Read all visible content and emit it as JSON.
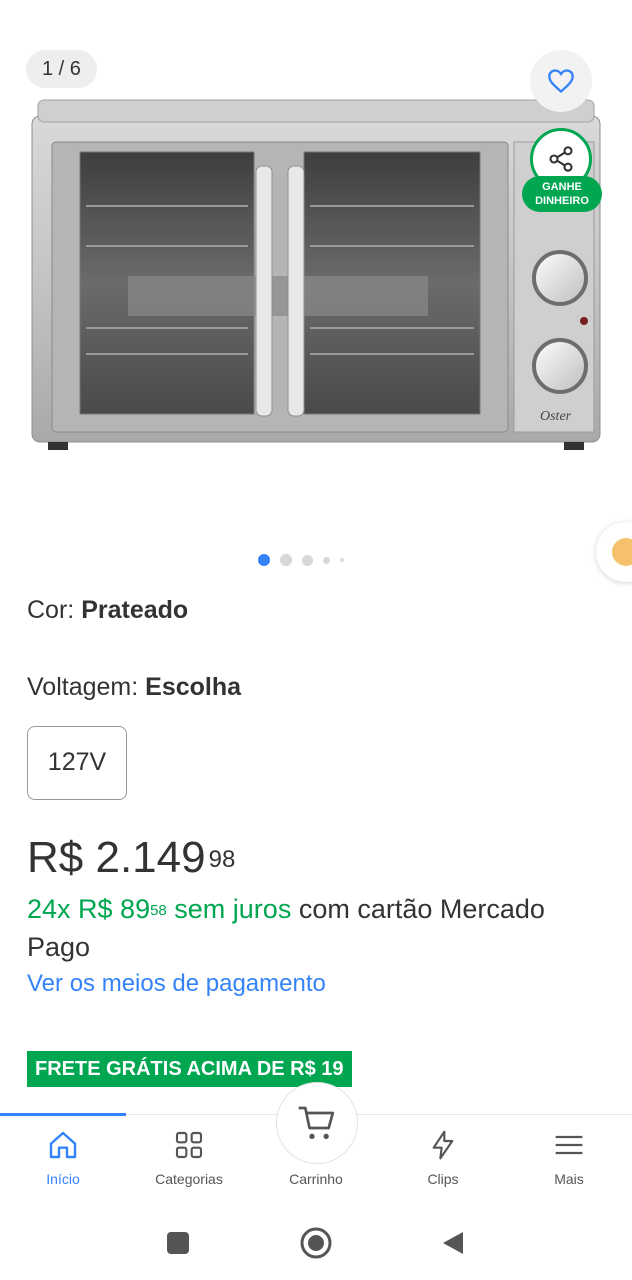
{
  "gallery": {
    "counter": "1 / 6",
    "current_slide": 1,
    "total_slides": 6,
    "share_badge": [
      "GANHE",
      "DINHEIRO"
    ],
    "brand_logo": "Oster",
    "favorite_icon": "heart-icon",
    "share_icon": "share-icon"
  },
  "variations": {
    "color_label": "Cor: ",
    "color_value": "Prateado",
    "voltage_label": "Voltagem: ",
    "voltage_value": "Escolha",
    "voltage_option": "127V"
  },
  "price": {
    "currency": "R$",
    "integer": "2.149",
    "cents": "98",
    "installments_prefix": "24x R$ 89",
    "installments_cents": "58",
    "installments_suffix": " sem juros",
    "installments_note": " com cartão Mercado Pago",
    "payment_link": "Ver os meios de pagamento"
  },
  "shipping_badge": "FRETE GRÁTIS ACIMA DE R$ 19",
  "bottom_nav": {
    "items": [
      {
        "label": "Início",
        "icon": "home-icon",
        "active": true
      },
      {
        "label": "Categorias",
        "icon": "grid-icon",
        "active": false
      },
      {
        "label": "Carrinho",
        "icon": "cart-icon",
        "active": false
      },
      {
        "label": "Clips",
        "icon": "lightning-icon",
        "active": false
      },
      {
        "label": "Mais",
        "icon": "menu-icon",
        "active": false
      }
    ]
  },
  "colors": {
    "accent_blue": "#3483fa",
    "green": "#00a650",
    "text": "#333333"
  }
}
